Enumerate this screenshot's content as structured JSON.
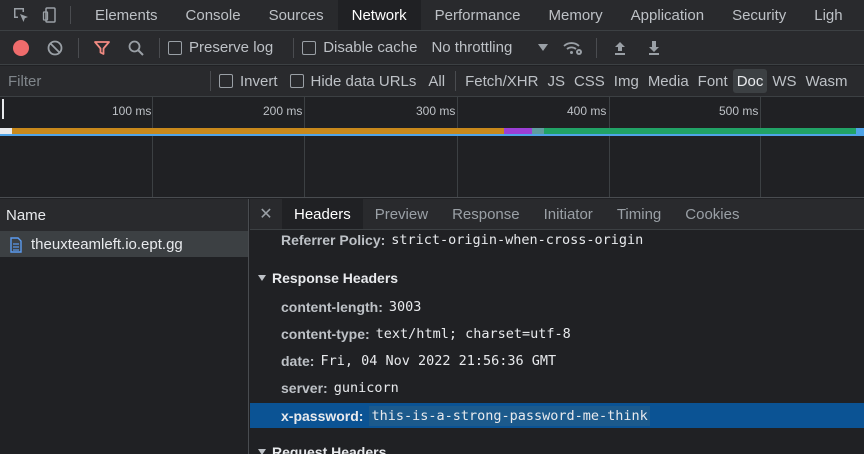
{
  "tabs": [
    "Elements",
    "Console",
    "Sources",
    "Network",
    "Performance",
    "Memory",
    "Application",
    "Security",
    "Ligh"
  ],
  "active_tab": "Network",
  "toolbar": {
    "preserve_log": "Preserve log",
    "disable_cache": "Disable cache",
    "throttling": "No throttling"
  },
  "filter": {
    "placeholder": "Filter",
    "invert": "Invert",
    "hide_data_urls": "Hide data URLs",
    "types": [
      "All",
      "Fetch/XHR",
      "JS",
      "CSS",
      "Img",
      "Media",
      "Font",
      "Doc",
      "WS",
      "Wasm"
    ],
    "active_type": "Doc"
  },
  "timeline": {
    "ticks": [
      "100 ms",
      "200 ms",
      "300 ms",
      "400 ms",
      "500 ms"
    ],
    "colors": {
      "waiting": "#c8891c",
      "script": "#9c3fd6",
      "blue": "#4fa4e8",
      "green": "#21a366"
    }
  },
  "requests": {
    "header": "Name",
    "items": [
      "theuxteamleft.io.ept.gg"
    ]
  },
  "details": {
    "tabs": [
      "Headers",
      "Preview",
      "Response",
      "Initiator",
      "Timing",
      "Cookies"
    ],
    "active_tab": "Headers",
    "referrer": {
      "name": "Referrer Policy:",
      "value": "strict-origin-when-cross-origin"
    },
    "response_section": "Response Headers",
    "response_headers": [
      {
        "name": "content-length:",
        "value": "3003"
      },
      {
        "name": "content-type:",
        "value": "text/html; charset=utf-8"
      },
      {
        "name": "date:",
        "value": "Fri, 04 Nov 2022 21:56:36 GMT"
      },
      {
        "name": "server:",
        "value": "gunicorn"
      },
      {
        "name": "x-password:",
        "value": "this-is-a-strong-password-me-think"
      }
    ],
    "request_section": "Request Headers"
  }
}
